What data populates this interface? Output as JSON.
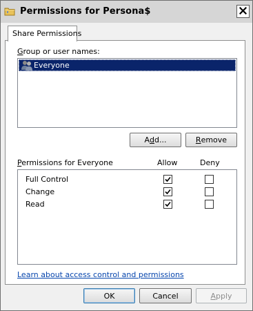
{
  "window": {
    "title": "Permissions for Persona$",
    "close_symbol": "✕"
  },
  "tabs": [
    {
      "label": "Share Permissions",
      "active": true
    }
  ],
  "group_section": {
    "label_prefix": "",
    "label_mnemonic": "G",
    "label_rest": "roup or user names:",
    "users": [
      {
        "name": "Everyone",
        "icon": "users-group-icon",
        "selected": true
      }
    ]
  },
  "user_buttons": {
    "add_mnemonic": "d",
    "add_pre": "A",
    "add_post": "d...",
    "add_label_full": "Add...",
    "remove_mnemonic": "R",
    "remove_pre": "",
    "remove_post": "emove",
    "remove_label_full": "Remove"
  },
  "permissions": {
    "header_mnemonic": "P",
    "header_rest": "ermissions for Everyone",
    "header_full": "Permissions for Everyone",
    "allow_header": "Allow",
    "deny_header": "Deny",
    "rows": [
      {
        "name": "Full Control",
        "allow": true,
        "deny": false
      },
      {
        "name": "Change",
        "allow": true,
        "deny": false
      },
      {
        "name": "Read",
        "allow": true,
        "deny": false
      }
    ]
  },
  "help_link": "Learn about access control and permissions",
  "dialog_buttons": {
    "ok": "OK",
    "cancel": "Cancel",
    "apply_mnemonic": "A",
    "apply_rest": "pply",
    "apply_full": "Apply",
    "apply_enabled": false
  }
}
